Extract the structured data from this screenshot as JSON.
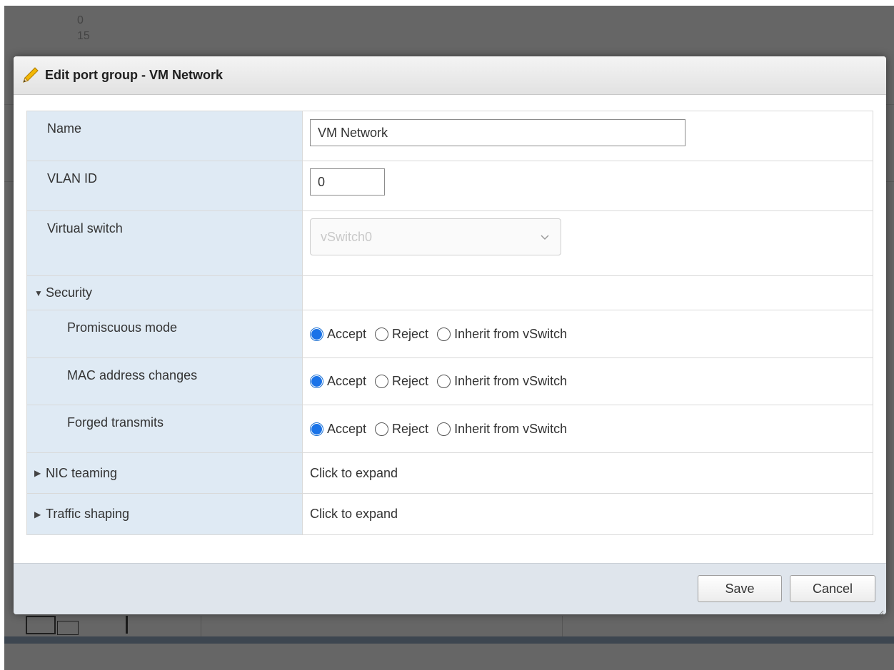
{
  "background": {
    "numbers": [
      "0",
      "15"
    ]
  },
  "dialog": {
    "title": "Edit port group - VM Network",
    "title_icon": "pencil-icon",
    "fields": {
      "name": {
        "label": "Name",
        "value": "VM Network"
      },
      "vlan": {
        "label": "VLAN ID",
        "value": "0"
      },
      "vswitch": {
        "label": "Virtual switch",
        "value": "vSwitch0",
        "disabled": true
      }
    },
    "security": {
      "label": "Security",
      "expanded": true,
      "options": [
        "Accept",
        "Reject",
        "Inherit from vSwitch"
      ],
      "promiscuous": {
        "label": "Promiscuous mode",
        "selected": "Accept"
      },
      "mac_changes": {
        "label": "MAC address changes",
        "selected": "Accept"
      },
      "forged": {
        "label": "Forged transmits",
        "selected": "Accept"
      }
    },
    "nic_teaming": {
      "label": "NIC teaming",
      "value": "Click to expand",
      "expanded": false
    },
    "traffic_shaping": {
      "label": "Traffic shaping",
      "value": "Click to expand",
      "expanded": false
    },
    "buttons": {
      "save": "Save",
      "cancel": "Cancel"
    }
  },
  "colors": {
    "label_bg": "#dfeaf4",
    "radio_checked": "#1a73e8",
    "footer_bg": "#dfe5ec",
    "overlay": "#666666"
  }
}
